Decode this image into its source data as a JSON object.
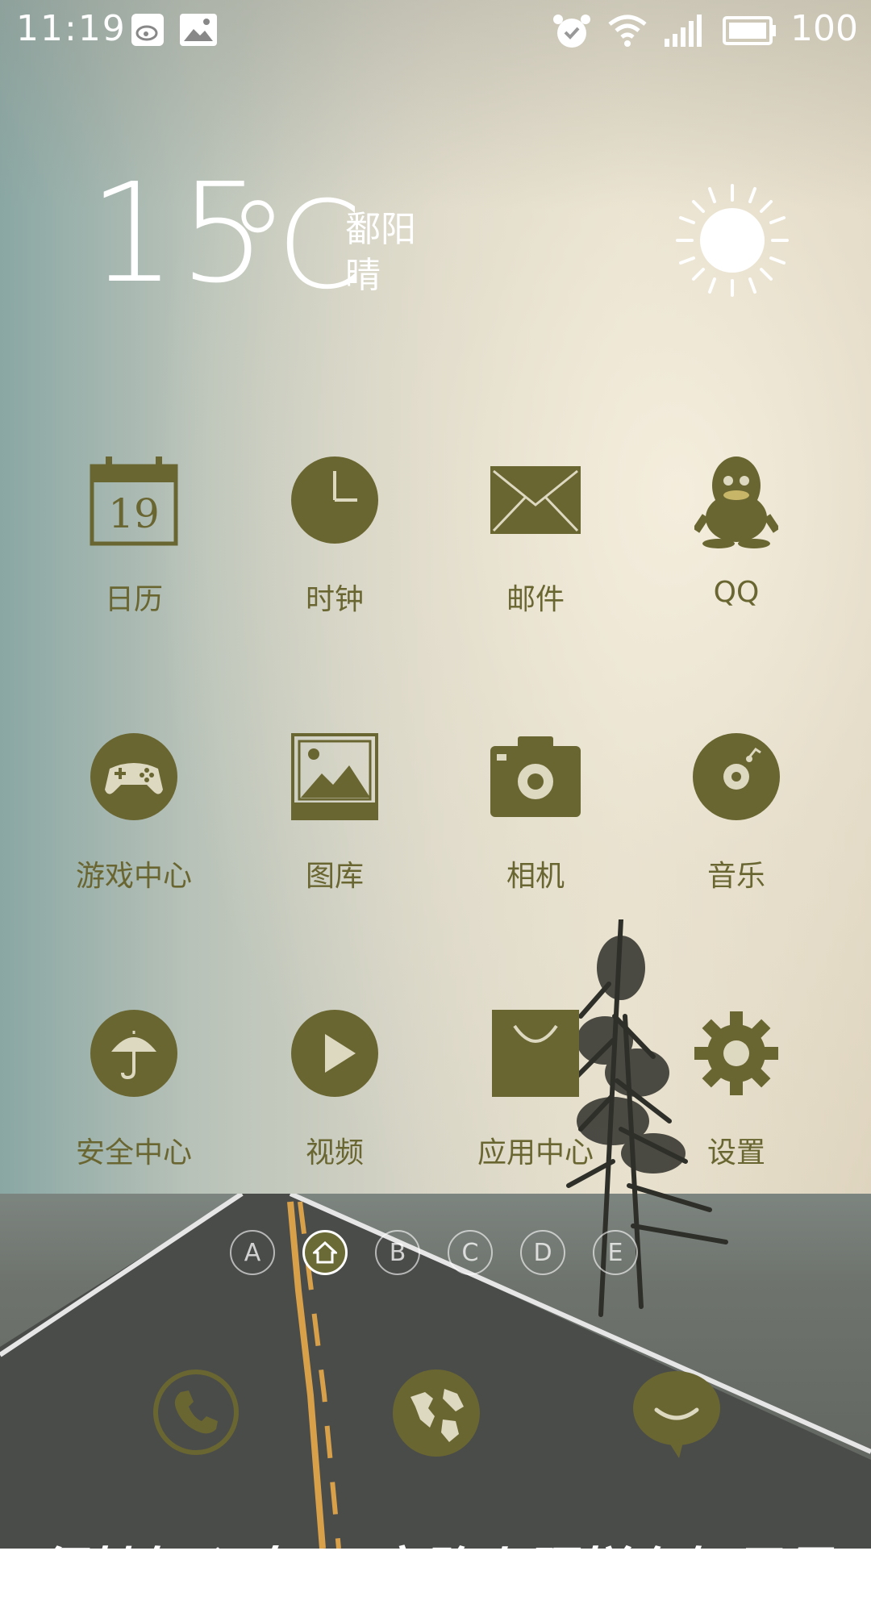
{
  "status_bar": {
    "time": "11:19",
    "battery": "100",
    "icons": [
      "weibo-icon",
      "image-icon",
      "alarm-icon",
      "wifi-icon",
      "signal-icon",
      "battery-icon"
    ]
  },
  "weather": {
    "temperature": "15",
    "unit": "℃",
    "city": "鄱阳",
    "condition": "晴",
    "icon": "sun-icon"
  },
  "apps": [
    {
      "label": "日历",
      "icon": "calendar-icon",
      "day": "19"
    },
    {
      "label": "时钟",
      "icon": "clock-icon"
    },
    {
      "label": "邮件",
      "icon": "mail-icon"
    },
    {
      "label": "QQ",
      "icon": "qq-penguin-icon"
    },
    {
      "label": "游戏中心",
      "icon": "gamepad-icon"
    },
    {
      "label": "图库",
      "icon": "gallery-icon"
    },
    {
      "label": "相机",
      "icon": "camera-icon"
    },
    {
      "label": "音乐",
      "icon": "music-disc-icon"
    },
    {
      "label": "安全中心",
      "icon": "umbrella-icon"
    },
    {
      "label": "视频",
      "icon": "play-icon"
    },
    {
      "label": "应用中心",
      "icon": "shopping-bag-icon"
    },
    {
      "label": "设置",
      "icon": "gear-icon"
    }
  ],
  "page_indicator": {
    "pages": [
      "A",
      "⌂",
      "B",
      "C",
      "D",
      "E"
    ],
    "active": "⌂"
  },
  "dock": {
    "icons": [
      "phone-icon",
      "globe-icon",
      "message-icon"
    ]
  },
  "wallpaper_text": {
    "left": "保持好心态,",
    "right": "弯路上照样有好风景"
  },
  "colors": {
    "icon_olive": "#6a6631",
    "text_white": "#ffffff"
  }
}
